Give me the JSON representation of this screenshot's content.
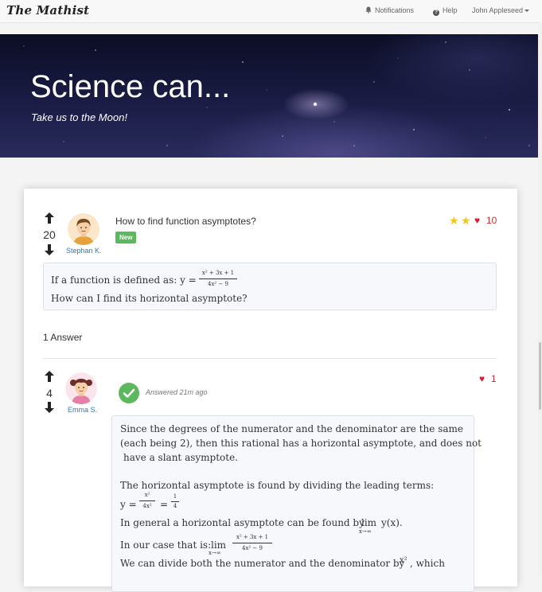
{
  "nav": {
    "brand": "The Mathist",
    "notifications": "Notifications",
    "help": "Help",
    "user": "John Appleseed"
  },
  "hero": {
    "title": "Science can...",
    "subtitle": "Take us to the Moon!"
  },
  "question": {
    "votes": "20",
    "author": "Stephan K.",
    "title": "How to find function asymptotes?",
    "badge": "New",
    "rating_stars": 2,
    "favorites": "10",
    "body": {
      "line1_prefix": "If a function is defined as: y =",
      "numerator": "x² + 3x + 1",
      "denominator": "4x² − 9",
      "line2": "How can I find its horizontal asymptote?"
    }
  },
  "answers_label": "1 Answer",
  "answer": {
    "votes": "4",
    "author": "Emma S.",
    "answered": "Answered 21m ago",
    "favorites": "1",
    "body": {
      "p1_l1": "Since the degrees of the numerator and the denominator are the same",
      "p1_l2": "(each being 2), then this rational has a horizontal asymptote, and does not",
      "p1_l3": "have a slant asymptote.",
      "p2": "The horizontal asymptote is found by dividing the leading terms:",
      "eq_prefix": "y =",
      "lead_num": "x²",
      "lead_den": "4x²",
      "equals": "=",
      "one": "1",
      "four": "4",
      "general_text": "In general a horizontal asymptote can be found by",
      "lim": "lim",
      "lim_sub": "x→∞",
      "yx": "y(x).",
      "our_case": "In our case that is:",
      "case_num": "x² + 3x + 1",
      "case_den": "4x² − 9",
      "divide_text": "We can divide both the numerator and the denominator by",
      "x2": "x²",
      "which": ", which"
    }
  },
  "colors": {
    "accent": "#337ab7",
    "success": "#5cb85c",
    "heart": "#e0192c",
    "star": "#f5c518"
  }
}
